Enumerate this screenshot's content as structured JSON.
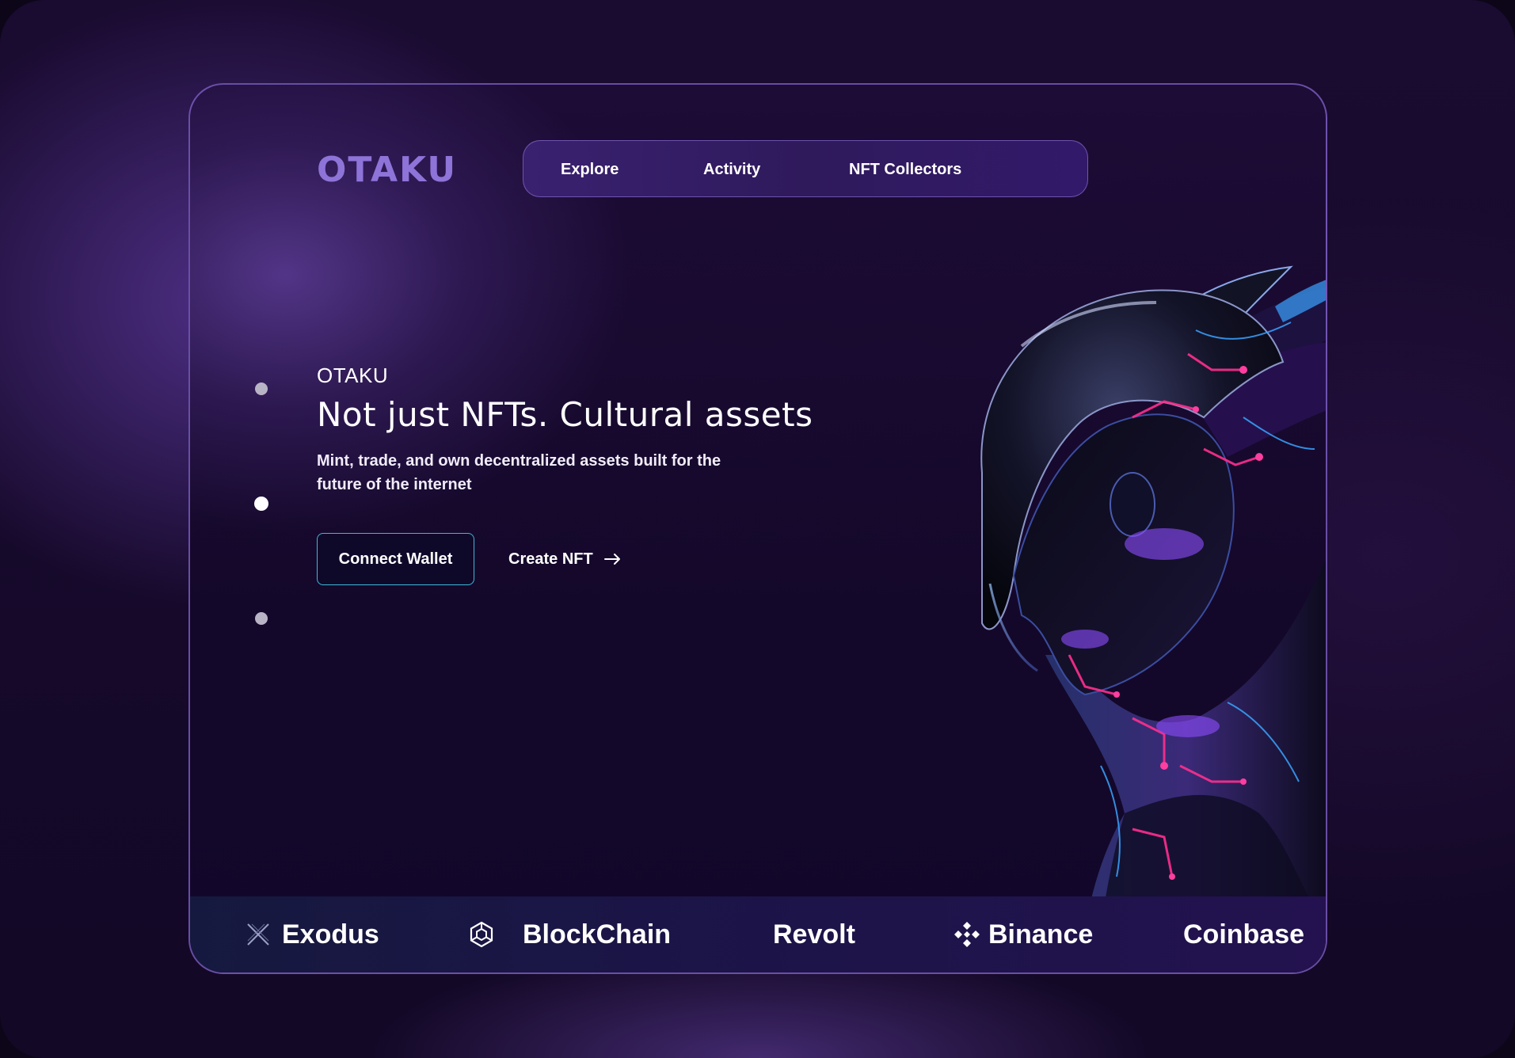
{
  "brand": {
    "logo": "OTAKU"
  },
  "nav": {
    "items": [
      {
        "label": "Explore"
      },
      {
        "label": "Activity"
      },
      {
        "label": "NFT Collectors"
      }
    ]
  },
  "pager": {
    "count": 3,
    "active_index": 1
  },
  "hero": {
    "eyebrow": "OTAKU",
    "headline": "Not just NFTs. Cultural assets",
    "subtitle": "Mint, trade, and own decentralized assets built for the future of the internet",
    "primary_button": "Connect Wallet",
    "secondary_button": "Create NFT",
    "secondary_icon": "arrow-right-icon",
    "image_icon": "cyber-android-portrait"
  },
  "partners": [
    {
      "name": "Exodus",
      "icon": "exodus-x-icon"
    },
    {
      "name": "BlockChain",
      "icon": "blockchain-cube-icon"
    },
    {
      "name": "Revolt",
      "icon": ""
    },
    {
      "name": "Binance",
      "icon": "binance-diamond-icon"
    },
    {
      "name": "Coinbase",
      "icon": ""
    }
  ],
  "colors": {
    "accent": "#8e73d8",
    "button_border": "#3fb8d8",
    "background": "#14082a",
    "neon_pink": "#ff2f8e",
    "neon_blue": "#3aa3ff"
  }
}
